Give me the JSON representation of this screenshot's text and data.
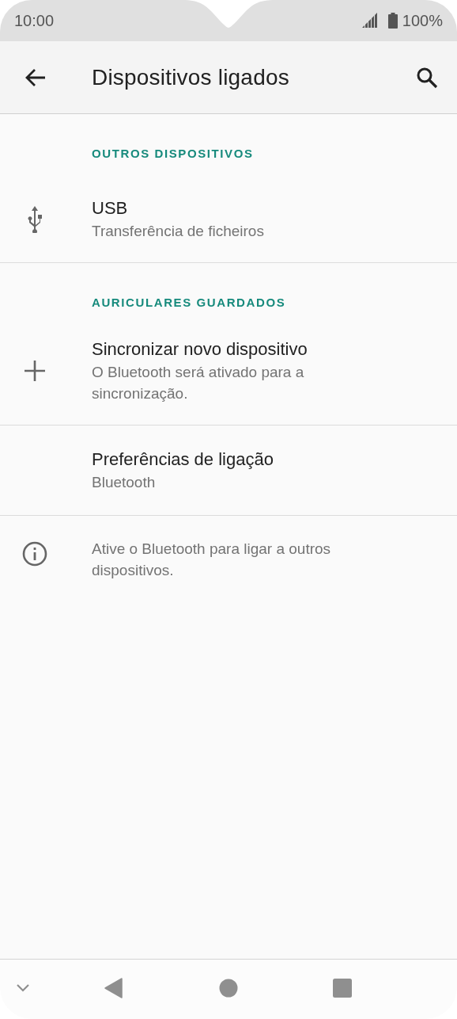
{
  "status_bar": {
    "time": "10:00",
    "battery": "100%"
  },
  "app_bar": {
    "title": "Dispositivos ligados"
  },
  "list": [
    {
      "kind": "header",
      "label": "OUTROS DISPOSITIVOS"
    },
    {
      "kind": "item",
      "title": "USB",
      "subtitle": "Transferência de ficheiros"
    },
    {
      "kind": "header",
      "label": "AURICULARES GUARDADOS"
    },
    {
      "kind": "item",
      "title": "Sincronizar novo dispositivo",
      "subtitle": "O Bluetooth será ativado para a sincronização."
    },
    {
      "kind": "item",
      "title": "Preferências de ligação",
      "subtitle": "Bluetooth"
    },
    {
      "kind": "info",
      "text": "Ative o Bluetooth para ligar a outros dispositivos."
    }
  ]
}
